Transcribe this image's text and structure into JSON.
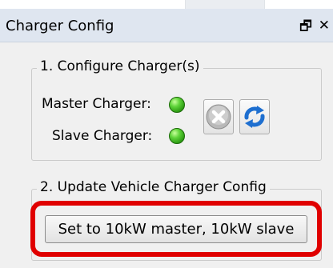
{
  "window": {
    "title": "Charger Config",
    "float_glyph": "🗗",
    "close_glyph": "✕"
  },
  "section1": {
    "title": "1. Configure Charger(s)",
    "master_label": "Master Charger:",
    "slave_label": "Slave Charger:",
    "master_status": "on",
    "slave_status": "on",
    "status_color": "#33b31a",
    "disconnect_icon": "cancel-icon",
    "refresh_icon": "refresh-icon"
  },
  "section2": {
    "title": "2. Update Vehicle Charger Config",
    "button_label": "Set to 10kW  master, 10kW slave"
  },
  "colors": {
    "highlight": "#e00000",
    "refresh_blue": "#1e6fd0"
  }
}
